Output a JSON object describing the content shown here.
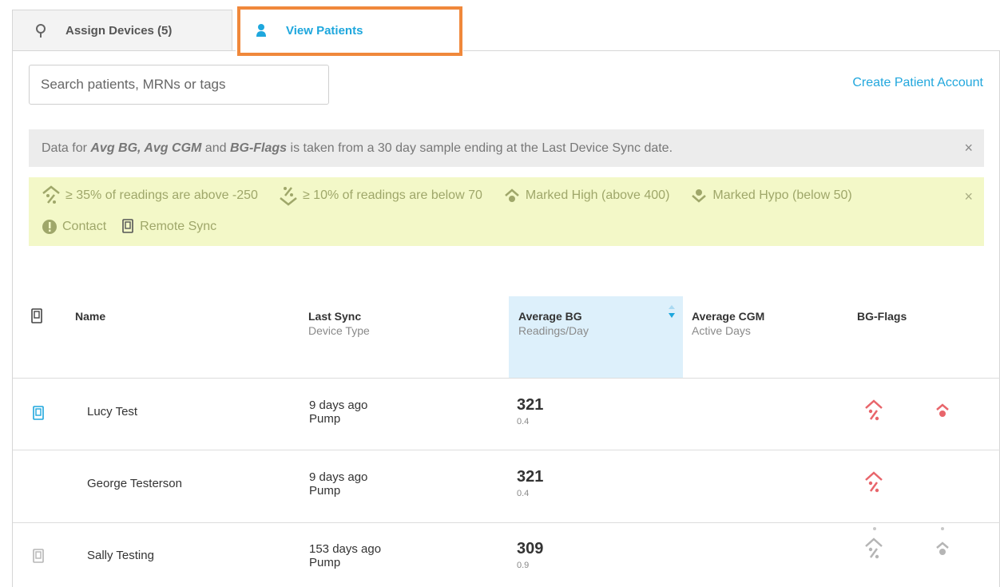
{
  "tabs": [
    {
      "label": "Assign Devices (5)",
      "icon": "device-icon"
    },
    {
      "label": "View Patients",
      "icon": "user-icon",
      "active": true
    }
  ],
  "search": {
    "placeholder": "Search patients, MRNs or tags"
  },
  "create_account_label": "Create Patient Account",
  "info_banner": {
    "prefix": "Data for ",
    "term1": "Avg BG, Avg CGM",
    "middle": " and ",
    "term2": "BG-Flags",
    "suffix": " is taken from a 30 day sample ending at the Last Device Sync date.",
    "close": "×"
  },
  "legend": {
    "items": [
      {
        "icon": "percent-above-icon",
        "label": "≥ 35% of readings are above -250"
      },
      {
        "icon": "percent-below-icon",
        "label": "≥ 10% of readings are below 70"
      },
      {
        "icon": "marked-high-icon",
        "label": "Marked High (above 400)"
      },
      {
        "icon": "marked-hypo-icon",
        "label": "Marked Hypo (below 50)"
      },
      {
        "icon": "contact-icon",
        "label": "Contact"
      },
      {
        "icon": "remote-sync-icon",
        "label": "Remote Sync"
      }
    ],
    "close": "×"
  },
  "table": {
    "headers": {
      "name": "Name",
      "last_sync": "Last Sync",
      "device_type": "Device Type",
      "avg_bg": "Average BG",
      "readings_day": "Readings/Day",
      "avg_cgm": "Average CGM",
      "active_days": "Active Days",
      "bg_flags": "BG-Flags"
    },
    "rows": [
      {
        "name": "Lucy Test",
        "last_sync": "9 days ago",
        "device": "Pump",
        "avg_bg": "321",
        "readings": "0.4"
      },
      {
        "name": "George Testerson",
        "last_sync": "9 days ago",
        "device": "Pump",
        "avg_bg": "321",
        "readings": "0.4"
      },
      {
        "name": "Sally Testing",
        "last_sync": "153 days ago",
        "device": "Pump",
        "avg_bg": "309",
        "readings": "0.9"
      }
    ]
  },
  "colors": {
    "accent": "#1ea7dd",
    "flag_red": "#e8656b",
    "flag_gray": "#b5b5b5",
    "highlight": "#f0883b"
  }
}
